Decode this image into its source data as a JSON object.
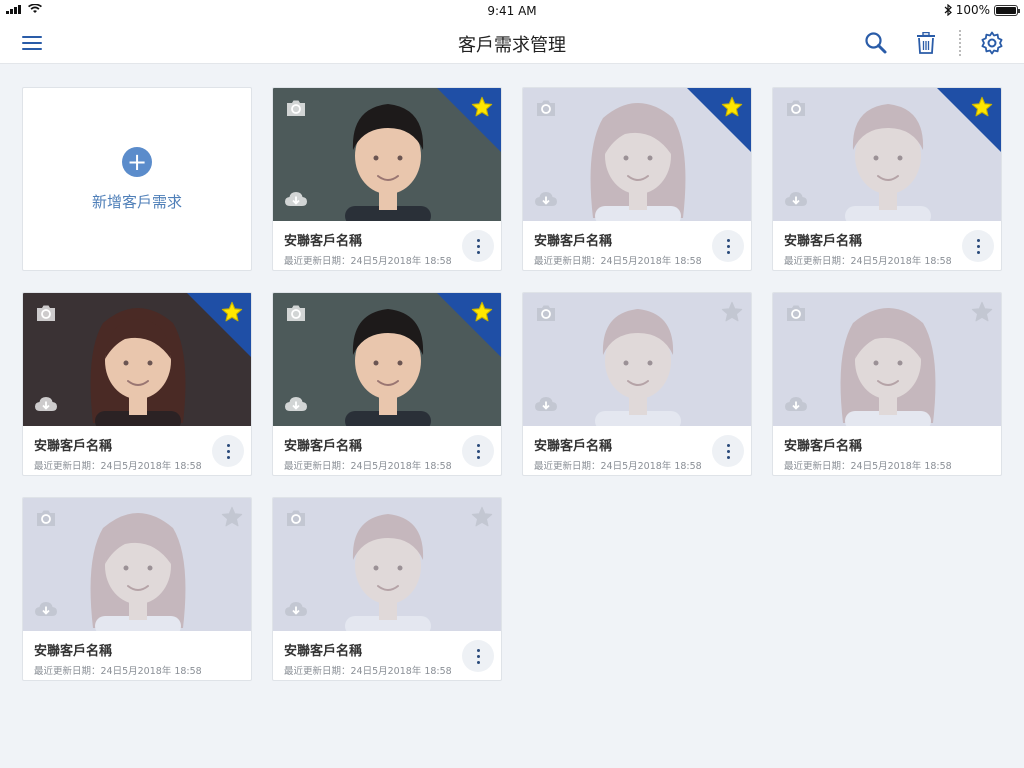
{
  "status": {
    "time": "9:41 AM",
    "battery": "100%"
  },
  "nav": {
    "title": "客戶需求管理",
    "icons": [
      "menu-icon",
      "search-icon",
      "trash-icon",
      "more-vertical-icon",
      "gear-icon"
    ]
  },
  "add_card": {
    "label": "新增客戶需求",
    "icon": "plus-icon"
  },
  "colors": {
    "accent": "#1f4fa6",
    "star": "#ffe600",
    "add": "#5b8ccb"
  },
  "cards": [
    {
      "name": "安聯客戶名稱",
      "date": "最近更新日期：24日5月2018年 18:58",
      "starred": true,
      "photo": "man",
      "placeholder": false,
      "menu": true
    },
    {
      "name": "安聯客戶名稱",
      "date": "最近更新日期：24日5月2018年 18:58",
      "starred": true,
      "photo": "woman",
      "placeholder": true,
      "menu": true
    },
    {
      "name": "安聯客戶名稱",
      "date": "最近更新日期：24日5月2018年 18:58",
      "starred": true,
      "photo": "man",
      "placeholder": true,
      "menu": true
    },
    {
      "name": "安聯客戶名稱",
      "date": "最近更新日期：24日5月2018年 18:58",
      "starred": true,
      "photo": "woman",
      "placeholder": false,
      "menu": true
    },
    {
      "name": "安聯客戶名稱",
      "date": "最近更新日期：24日5月2018年 18:58",
      "starred": true,
      "photo": "man",
      "placeholder": false,
      "menu": true
    },
    {
      "name": "安聯客戶名稱",
      "date": "最近更新日期：24日5月2018年 18:58",
      "starred": false,
      "photo": "man",
      "placeholder": true,
      "menu": true
    },
    {
      "name": "安聯客戶名稱",
      "date": "最近更新日期：24日5月2018年 18:58",
      "starred": false,
      "photo": "woman",
      "placeholder": true,
      "menu": false
    },
    {
      "name": "安聯客戶名稱",
      "date": "最近更新日期：24日5月2018年 18:58",
      "starred": false,
      "photo": "woman",
      "placeholder": true,
      "menu": false
    },
    {
      "name": "安聯客戶名稱",
      "date": "最近更新日期：24日5月2018年 18:58",
      "starred": false,
      "photo": "man",
      "placeholder": true,
      "menu": true
    }
  ]
}
